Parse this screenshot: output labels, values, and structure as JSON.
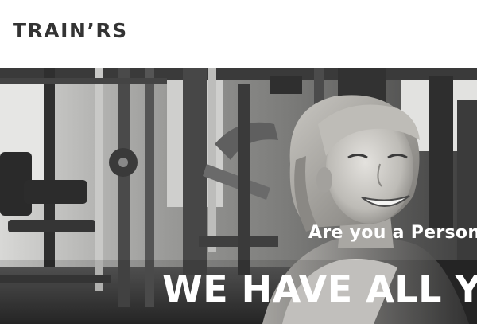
{
  "brand": {
    "logo_text": "TRAIN’RS"
  },
  "hero": {
    "subtitle": "Are you a Person",
    "title": "WE HAVE ALL Y",
    "image": "black-and-white photo of smiling woman in a gym with workout machines"
  }
}
